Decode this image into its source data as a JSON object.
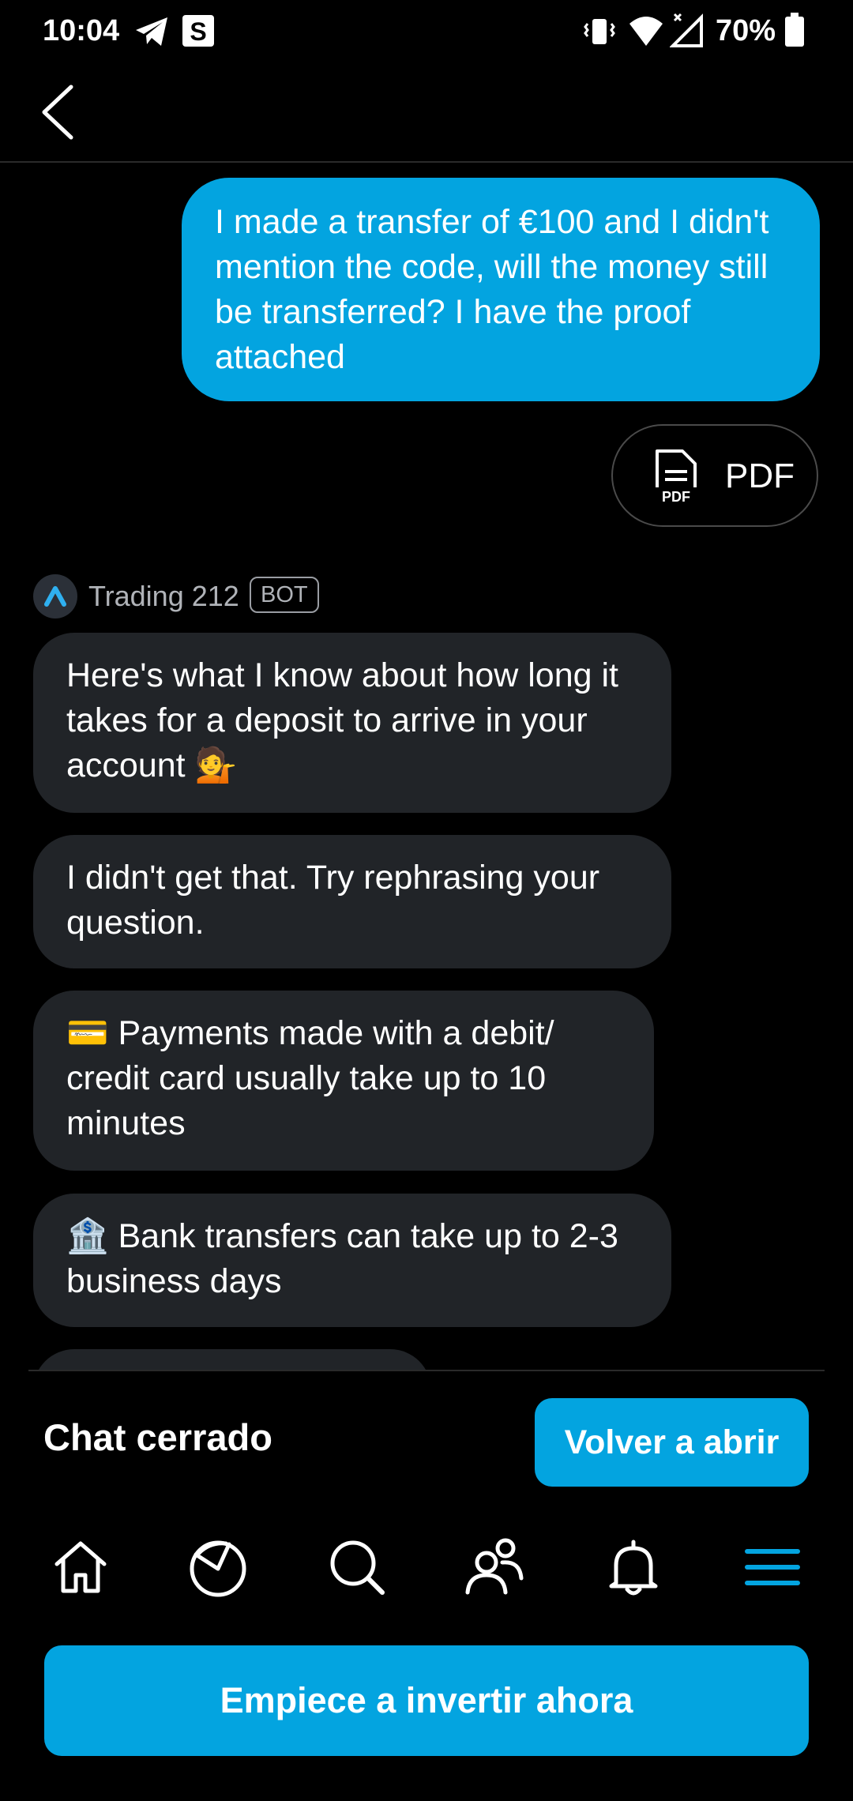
{
  "status_bar": {
    "time": "10:04",
    "battery": "70%",
    "icons": [
      "telegram-icon",
      "s-app-icon",
      "vibrate-icon",
      "wifi-icon",
      "signal-icon",
      "battery-icon"
    ]
  },
  "header": {
    "back_icon": "chevron-left-icon"
  },
  "messages": {
    "user": "I made a transfer of €100 and I didn't mention the code, will the money still be transferred?  I have the proof attached",
    "attachment_label": "PDF",
    "attachment_icon_text": "PDF",
    "bot_name": "Trading 212",
    "bot_badge": "BOT",
    "bot": [
      "Here's what I know about how long it takes for a deposit to arrive in your account 💁",
      "I didn't get that. Try rephrasing your question.",
      "💳 Payments made with a debit/ credit card usually take up to 10 minutes",
      "🏦 Bank transfers can take up to 2-3 business days"
    ]
  },
  "chat_closed": {
    "label": "Chat cerrado",
    "reopen_button": "Volver a abrir"
  },
  "nav": [
    "home-icon",
    "portfolio-pie-icon",
    "search-icon",
    "community-icon",
    "bell-icon",
    "menu-icon"
  ],
  "cta": "Empiece a invertir ahora",
  "colors": {
    "accent": "#03a4e0",
    "bot_bubble": "#212428",
    "background": "#000000"
  }
}
